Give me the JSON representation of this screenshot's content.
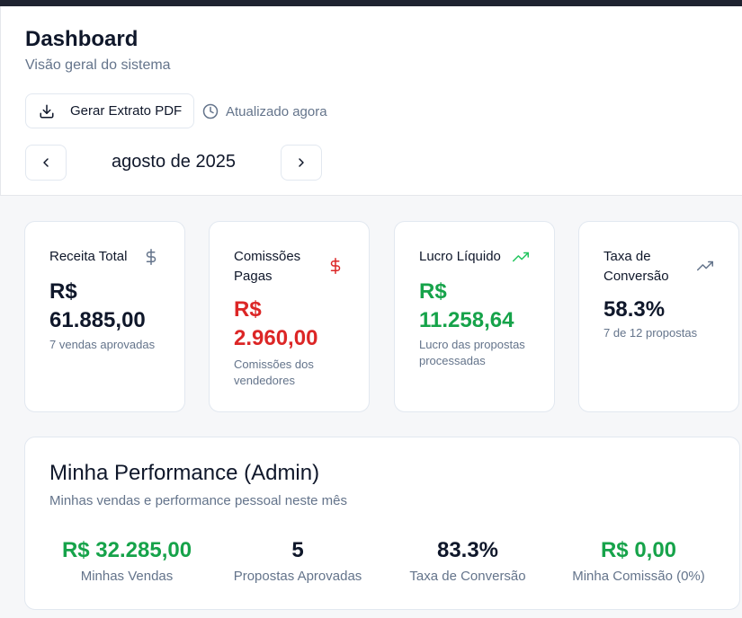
{
  "header": {
    "title": "Dashboard",
    "subtitle": "Visão geral do sistema",
    "pdf_button_label": "Gerar Extrato PDF",
    "updated_label": "Atualizado agora",
    "month_label": "agosto de 2025"
  },
  "cards": [
    {
      "title": "Receita Total",
      "value_prefix": "R$",
      "value": "61.885,00",
      "desc": "7 vendas aprovadas",
      "icon": "dollar-icon",
      "value_color": "#0f172a"
    },
    {
      "title": "Comissões Pagas",
      "value_prefix": "R$",
      "value": "2.960,00",
      "desc": "Comissões dos vendedores",
      "icon": "dollar-icon",
      "value_color": "#dc2626"
    },
    {
      "title": "Lucro Líquido",
      "value_prefix": "R$",
      "value": "11.258,64",
      "desc": "Lucro das propostas processadas",
      "icon": "trending-up-icon",
      "value_color": "#16a34a"
    },
    {
      "title": "Taxa de Conversão",
      "value": "58.3%",
      "desc": "7 de 12 propostas",
      "icon": "trending-up-icon",
      "value_color": "#0f172a"
    }
  ],
  "performance": {
    "title": "Minha Performance (Admin)",
    "subtitle": "Minhas vendas e performance pessoal neste mês",
    "metrics": [
      {
        "value": "R$ 32.285,00",
        "label": "Minhas Vendas"
      },
      {
        "value": "5",
        "label": "Propostas Aprovadas"
      },
      {
        "value": "83.3%",
        "label": "Taxa de Conversão"
      },
      {
        "value": "R$ 0,00",
        "label": "Minha Comissão (0%)"
      }
    ]
  }
}
